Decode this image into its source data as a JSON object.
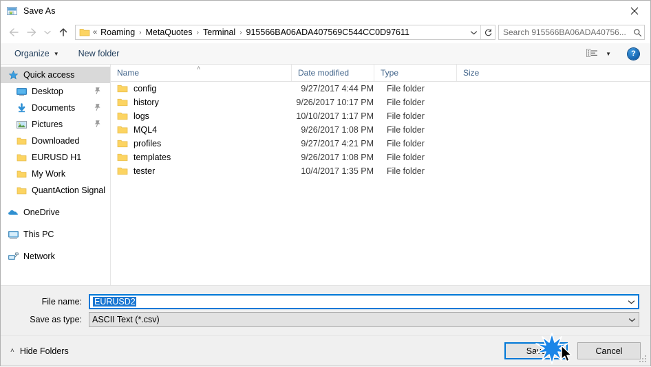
{
  "window": {
    "title": "Save As",
    "icon": "save-as-icon",
    "close_label": "✕"
  },
  "nav": {
    "back": "←",
    "forward": "→",
    "recent": "∨",
    "up": "↑",
    "refresh": "↻",
    "dropdown": "∨"
  },
  "address": {
    "prefix": "«",
    "separator": "›",
    "crumbs": [
      "Roaming",
      "MetaQuotes",
      "Terminal",
      "915566BA06ADA407569C544CC0D97611"
    ]
  },
  "search": {
    "placeholder": "Search 915566BA06ADA40756...",
    "icon": "magnifier-icon"
  },
  "toolbar": {
    "organize": "Organize",
    "organize_caret": "▼",
    "new_folder": "New folder",
    "view_icon": "view-options-icon",
    "view_caret": "▼",
    "help": "?"
  },
  "sidebar": {
    "items": [
      {
        "label": "Quick access",
        "icon": "star-icon",
        "selected": true,
        "root": true,
        "pinned": false
      },
      {
        "label": "Desktop",
        "icon": "desktop-icon",
        "selected": false,
        "root": false,
        "pinned": true
      },
      {
        "label": "Documents",
        "icon": "documents-download-icon",
        "selected": false,
        "root": false,
        "pinned": true
      },
      {
        "label": "Pictures",
        "icon": "pictures-icon",
        "selected": false,
        "root": false,
        "pinned": true
      },
      {
        "label": "Downloaded",
        "icon": "folder-icon",
        "selected": false,
        "root": false,
        "pinned": false
      },
      {
        "label": "EURUSD H1",
        "icon": "folder-icon",
        "selected": false,
        "root": false,
        "pinned": false
      },
      {
        "label": "My Work",
        "icon": "folder-icon",
        "selected": false,
        "root": false,
        "pinned": false
      },
      {
        "label": "QuantAction Signal",
        "icon": "folder-icon",
        "selected": false,
        "root": false,
        "pinned": false
      },
      {
        "label": "OneDrive",
        "icon": "onedrive-cloud-icon",
        "selected": false,
        "root": true,
        "pinned": false
      },
      {
        "label": "This PC",
        "icon": "this-pc-icon",
        "selected": false,
        "root": true,
        "pinned": false
      },
      {
        "label": "Network",
        "icon": "network-icon",
        "selected": false,
        "root": true,
        "pinned": false
      }
    ],
    "pin_glyph": "📌"
  },
  "filelist": {
    "columns": [
      "Name",
      "Date modified",
      "Type",
      "Size"
    ],
    "sort_caret": "˄",
    "rows": [
      {
        "name": "config",
        "date": "9/27/2017 4:44 PM",
        "type": "File folder",
        "size": ""
      },
      {
        "name": "history",
        "date": "9/26/2017 10:17 PM",
        "type": "File folder",
        "size": ""
      },
      {
        "name": "logs",
        "date": "10/10/2017 1:17 PM",
        "type": "File folder",
        "size": ""
      },
      {
        "name": "MQL4",
        "date": "9/26/2017 1:08 PM",
        "type": "File folder",
        "size": ""
      },
      {
        "name": "profiles",
        "date": "9/27/2017 4:21 PM",
        "type": "File folder",
        "size": ""
      },
      {
        "name": "templates",
        "date": "9/26/2017 1:08 PM",
        "type": "File folder",
        "size": ""
      },
      {
        "name": "tester",
        "date": "10/4/2017 1:35 PM",
        "type": "File folder",
        "size": ""
      }
    ]
  },
  "form": {
    "filename_label": "File name:",
    "filename_value": "EURUSD2",
    "filetype_label": "Save as type:",
    "filetype_value": "ASCII Text (*.csv)",
    "combo_arrow": "∨"
  },
  "footer": {
    "hide_folders": "Hide Folders",
    "hide_caret": "˄",
    "save": "Save",
    "cancel": "Cancel"
  },
  "colors": {
    "accent": "#0078d7",
    "selection": "#1b77d2",
    "header_text": "#41648a",
    "folder_yellow": "#fcd462",
    "sidebar_selected": "#d9d9d9"
  }
}
